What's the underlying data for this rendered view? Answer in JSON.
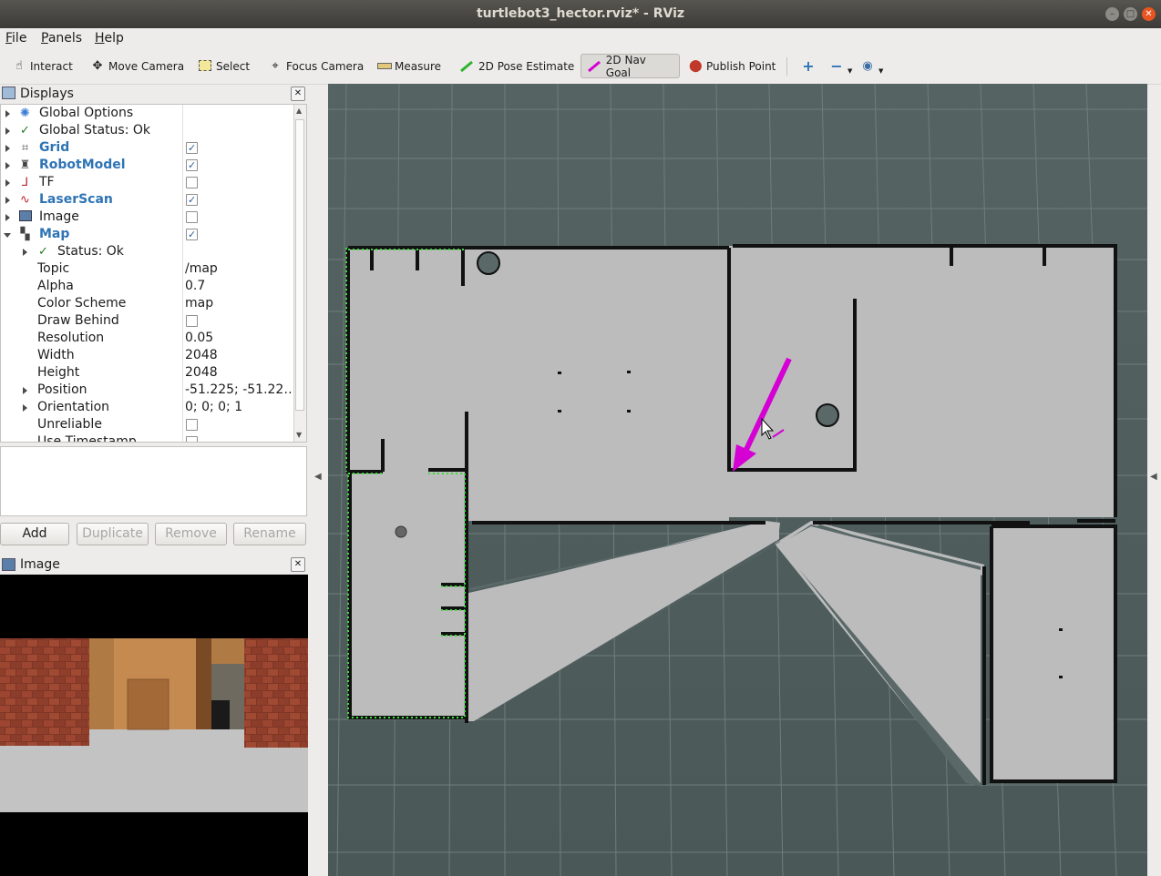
{
  "window": {
    "title": "turtlebot3_hector.rviz* - RViz"
  },
  "menubar": {
    "items": [
      {
        "label": "File",
        "mnemonic": "F",
        "rest": "ile"
      },
      {
        "label": "Panels",
        "mnemonic": "P",
        "rest": "anels"
      },
      {
        "label": "Help",
        "mnemonic": "H",
        "rest": "elp"
      }
    ]
  },
  "toolbar": {
    "interact": "Interact",
    "move_camera": "Move Camera",
    "select": "Select",
    "focus_camera": "Focus Camera",
    "measure": "Measure",
    "pose_estimate": "2D Pose Estimate",
    "nav_goal": "2D Nav Goal",
    "publish_point": "Publish Point",
    "active_tool": "2D Nav Goal",
    "nav_goal_color": "#d400d4",
    "pose_color": "#2db52d"
  },
  "displays": {
    "title": "Displays",
    "tree": [
      {
        "label": "Global Options"
      },
      {
        "label": "Global Status: Ok"
      },
      {
        "label": "Grid",
        "checked": true
      },
      {
        "label": "RobotModel",
        "checked": true
      },
      {
        "label": "TF",
        "checked": false
      },
      {
        "label": "LaserScan",
        "checked": true
      },
      {
        "label": "Image",
        "checked": false
      },
      {
        "label": "Map",
        "checked": true
      },
      {
        "label": "Status: Ok"
      },
      {
        "label": "Topic",
        "value": "/map"
      },
      {
        "label": "Alpha",
        "value": "0.7"
      },
      {
        "label": "Color Scheme",
        "value": "map"
      },
      {
        "label": "Draw Behind",
        "checked": false
      },
      {
        "label": "Resolution",
        "value": "0.05"
      },
      {
        "label": "Width",
        "value": "2048"
      },
      {
        "label": "Height",
        "value": "2048"
      },
      {
        "label": "Position",
        "value": "-51.225; -51.22…"
      },
      {
        "label": "Orientation",
        "value": "0; 0; 0; 1"
      },
      {
        "label": "Unreliable",
        "checked": false
      },
      {
        "label": "Use Timestamp",
        "checked": false
      }
    ],
    "buttons": {
      "add": "Add",
      "duplicate": "Duplicate",
      "remove": "Remove",
      "rename": "Rename"
    }
  },
  "image_panel": {
    "title": "Image"
  },
  "colors": {
    "map_unknown": "#4f5e5e",
    "map_free": "#bcbcbc",
    "map_occupied": "#111111",
    "laser_scan": "#3ddc3d",
    "grid": "#a0aaaa",
    "nav_arrow": "#d400d4",
    "display_label_blue": "#2e74b5"
  }
}
